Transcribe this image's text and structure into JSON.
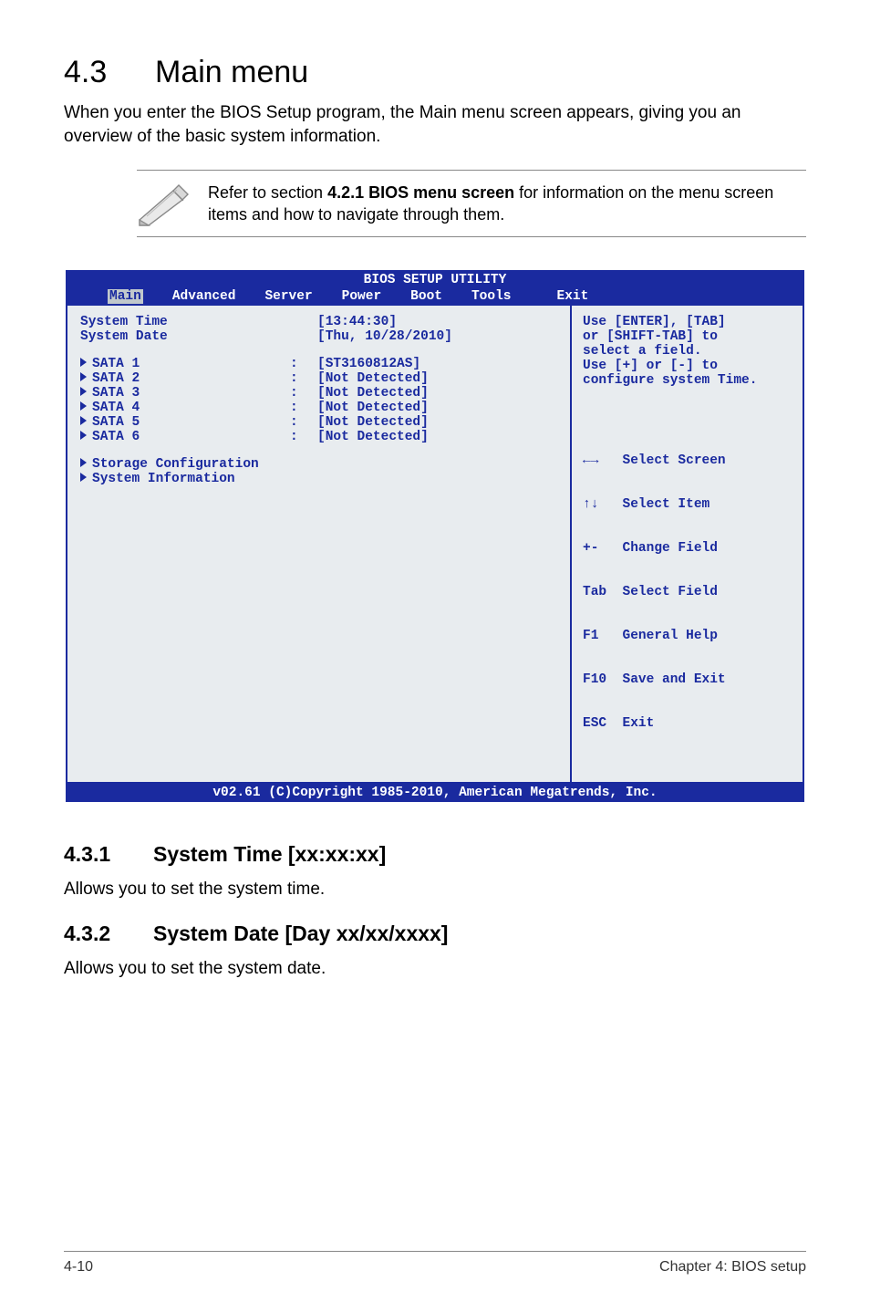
{
  "heading": {
    "number": "4.3",
    "title": "Main menu"
  },
  "intro": "When you enter the BIOS Setup program, the Main menu screen appears, giving you an overview of the basic system information.",
  "note": {
    "pre": "Refer to section ",
    "bold": "4.2.1 BIOS menu screen",
    "post": " for information on the menu screen items and how to navigate through them."
  },
  "bios": {
    "title": "BIOS SETUP UTILITY",
    "tabs": [
      "Main",
      "Advanced",
      "Server",
      "Power",
      "Boot",
      "Tools",
      "Exit"
    ],
    "selected_tab": "Main",
    "items": {
      "system_time": {
        "label": "System Time",
        "value": "[13:44:30]"
      },
      "system_date": {
        "label": "System Date",
        "value": "[Thu, 10/28/2010]"
      },
      "sata": [
        {
          "label": "SATA 1",
          "value": "[ST3160812AS]"
        },
        {
          "label": "SATA 2",
          "value": "[Not Detected]"
        },
        {
          "label": "SATA 3",
          "value": "[Not Detected]"
        },
        {
          "label": "SATA 4",
          "value": "[Not Detected]"
        },
        {
          "label": "SATA 5",
          "value": "[Not Detected]"
        },
        {
          "label": "SATA 6",
          "value": "[Not Detected]"
        }
      ],
      "storage_cfg": "Storage Configuration",
      "sys_info": "System Information"
    },
    "help_top": [
      "Use [ENTER], [TAB]",
      "or [SHIFT-TAB] to",
      "select a field.",
      "",
      "Use [+] or [-] to",
      "configure system Time."
    ],
    "help_keys": [
      "←→   Select Screen",
      "↑↓   Select Item",
      "+-   Change Field",
      "Tab  Select Field",
      "F1   General Help",
      "F10  Save and Exit",
      "ESC  Exit"
    ],
    "footer": "v02.61 (C)Copyright 1985-2010, American Megatrends, Inc."
  },
  "sub1": {
    "num": "4.3.1",
    "title": "System Time [xx:xx:xx]",
    "body": "Allows you to set the system time."
  },
  "sub2": {
    "num": "4.3.2",
    "title": "System Date [Day xx/xx/xxxx]",
    "body": "Allows you to set the system date."
  },
  "footer": {
    "left": "4-10",
    "right": "Chapter 4: BIOS setup"
  }
}
